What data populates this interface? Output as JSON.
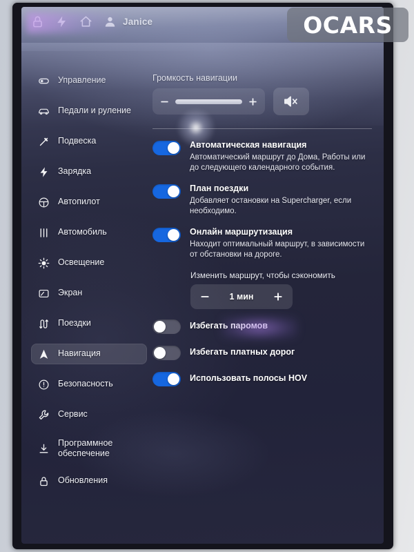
{
  "watermark": {
    "text": "OCARS"
  },
  "topbar": {
    "icons": [
      "lock-icon",
      "bolt-icon",
      "home-icon",
      "person-icon"
    ],
    "user_name": "Janice"
  },
  "sidebar": {
    "items": [
      {
        "label": "Управление",
        "icon": "toggle-icon",
        "active": false
      },
      {
        "label": "Педали и руление",
        "icon": "car-icon",
        "active": false
      },
      {
        "label": "Подвеска",
        "icon": "suspension-icon",
        "active": false
      },
      {
        "label": "Зарядка",
        "icon": "bolt-icon",
        "active": false
      },
      {
        "label": "Автопилот",
        "icon": "steering-icon",
        "active": false
      },
      {
        "label": "Автомобиль",
        "icon": "sliders-icon",
        "active": false
      },
      {
        "label": "Освещение",
        "icon": "sun-icon",
        "active": false
      },
      {
        "label": "Экран",
        "icon": "display-icon",
        "active": false
      },
      {
        "label": "Поездки",
        "icon": "trips-icon",
        "active": false
      },
      {
        "label": "Навигация",
        "icon": "navigation-icon",
        "active": true
      },
      {
        "label": "Безопасность",
        "icon": "alert-icon",
        "active": false
      },
      {
        "label": "Сервис",
        "icon": "wrench-icon",
        "active": false
      },
      {
        "label": "Программное\nобеспечение",
        "icon": "download-icon",
        "active": false
      },
      {
        "label": "Обновления",
        "icon": "lock-icon",
        "active": false
      }
    ]
  },
  "main": {
    "volume": {
      "label": "Громкость навигации",
      "decrease_icon": "minus-icon",
      "increase_icon": "plus-icon",
      "fill_percent": 100,
      "mute_icon": "speaker-mute-icon"
    },
    "toggles": [
      {
        "title": "Автоматическая навигация",
        "desc": "Автоматический маршрут до Дома, Работы или до следующего календарного события.",
        "on": true
      },
      {
        "title": "План поездки",
        "desc": "Добавляет остановки на Supercharger, если необходимо.",
        "on": true
      },
      {
        "title": "Онлайн маршрутизация",
        "desc": "Находит оптимальный маршрут, в зависимости от обстановки на дороге.",
        "on": true
      }
    ],
    "stepper": {
      "label": "Изменить маршрут, чтобы сэкономить",
      "value": "1 мин",
      "decrease_icon": "minus-icon",
      "increase_icon": "plus-icon"
    },
    "simple_toggles": [
      {
        "title": "Избегать паромов",
        "on": false
      },
      {
        "title": "Избегать платных дорог",
        "on": false
      },
      {
        "title": "Использовать полосы HOV",
        "on": true
      }
    ]
  },
  "colors": {
    "accent_on": "#1667e0",
    "screen_bg": "#24253a",
    "text": "#ffffff"
  }
}
